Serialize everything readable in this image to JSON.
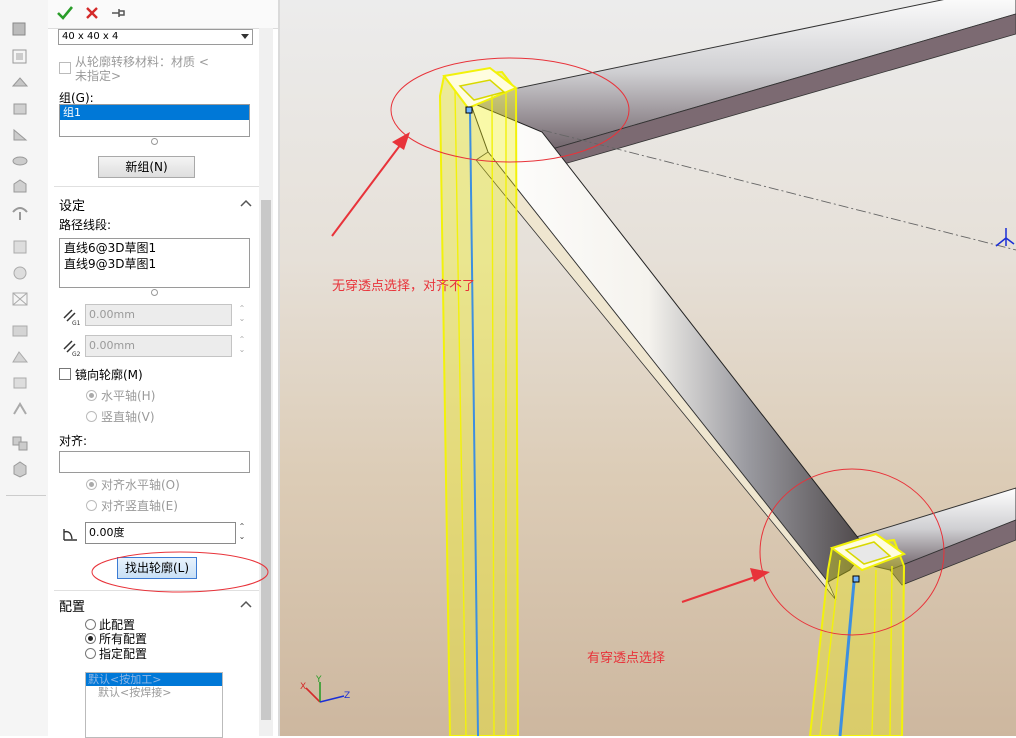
{
  "toolbar": {
    "ok_icon": "check-icon",
    "cancel_icon": "close-icon",
    "pin_icon": "pushpin-icon"
  },
  "profile": {
    "size_value": "40 x 40 x 4",
    "transfer_material_label_line1": "从轮廓转移材料：材质 <",
    "transfer_material_label_line2": "未指定>"
  },
  "groups": {
    "label": "组(G):",
    "items": [
      "组1"
    ],
    "new_group_button": "新组(N)"
  },
  "settings": {
    "title": "设定",
    "path_segments_label": "路径线段:",
    "path_segments": [
      "直线6@3D草图1",
      "直线9@3D草图1"
    ],
    "g1_value": "0.00mm",
    "g1_tag": "G1",
    "g2_value": "0.00mm",
    "g2_tag": "G2",
    "mirror_label": "镜向轮廓(M)",
    "mirror_horizontal": "水平轴(H)",
    "mirror_vertical": "竖直轴(V)",
    "align_label": "对齐:",
    "align_value": "",
    "align_horizontal": "对齐水平轴(O)",
    "align_vertical": "对齐竖直轴(E)",
    "angle_value": "0.00度",
    "locate_profile_button": "找出轮廓(L)"
  },
  "configuration": {
    "title": "配置",
    "options": [
      "此配置",
      "所有配置",
      "指定配置"
    ],
    "selected": "所有配置",
    "list_items": [
      "默认<按加工>",
      "默认<按焊接>"
    ]
  },
  "annotations": {
    "top": "无穿透点选择，对齐不了",
    "bottom": "有穿透点选择"
  },
  "triad": {
    "x": "X",
    "y": "Y",
    "z": "Z"
  },
  "colors": {
    "accent_selection": "#0078d7",
    "annotation_red": "#e8333a",
    "highlight_yellow": "#f2f20a",
    "ok_green": "#2a9d2a",
    "cancel_red": "#d42a2a"
  }
}
